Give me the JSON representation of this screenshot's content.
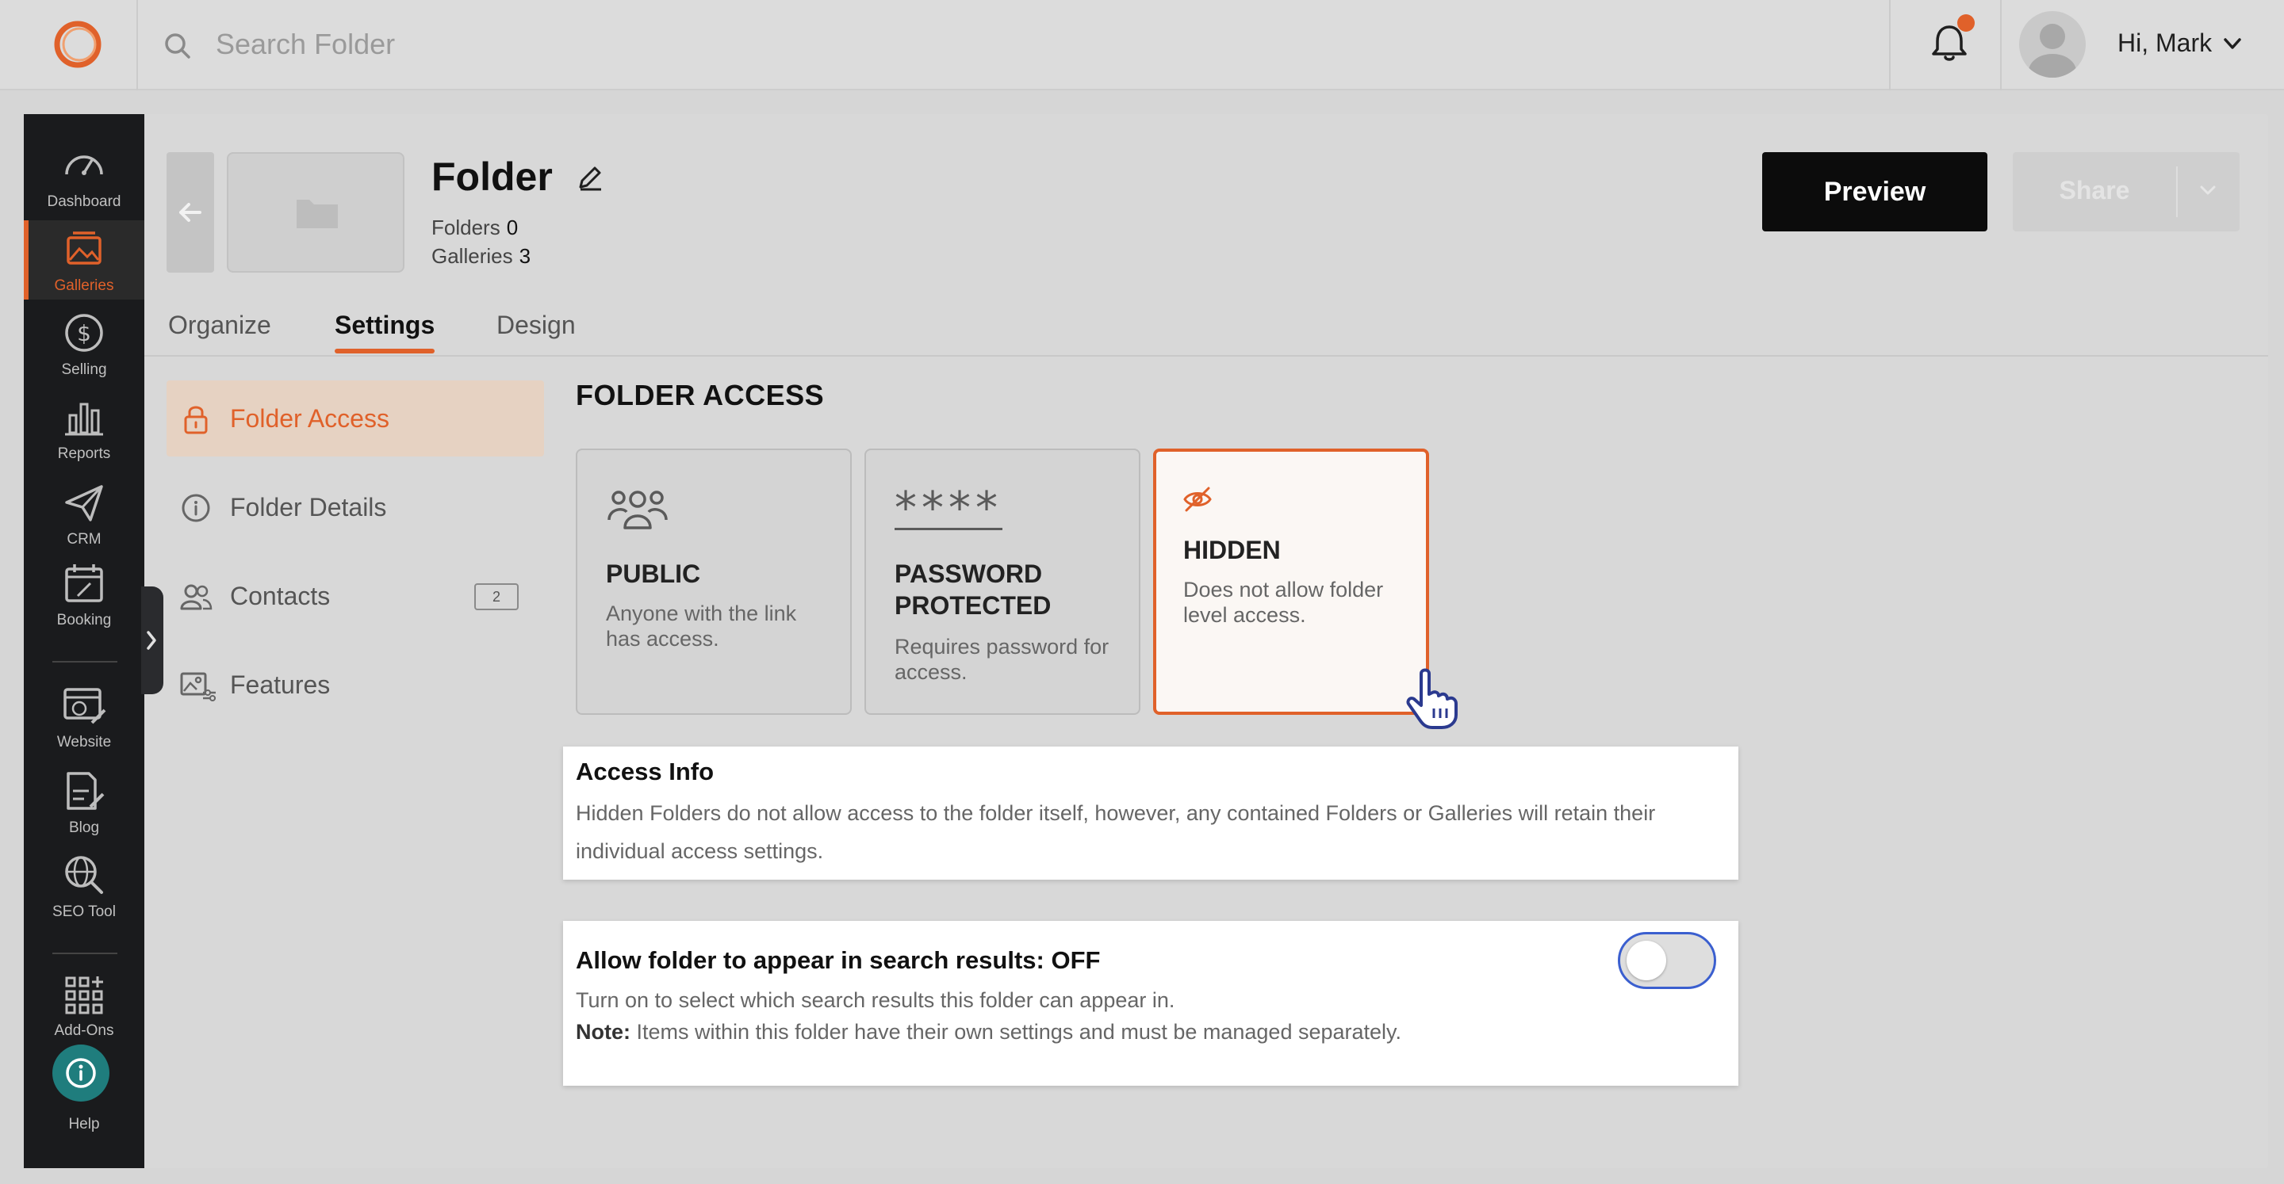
{
  "topbar": {
    "search_placeholder": "Search Folder",
    "greeting": "Hi, Mark"
  },
  "nav": {
    "items": [
      {
        "label": "Dashboard",
        "icon": "dashboard-icon"
      },
      {
        "label": "Galleries",
        "icon": "gallery-icon",
        "active": true
      },
      {
        "label": "Selling",
        "icon": "dollar-icon"
      },
      {
        "label": "Reports",
        "icon": "bar-chart-icon"
      },
      {
        "label": "CRM",
        "icon": "paper-plane-icon"
      },
      {
        "label": "Booking",
        "icon": "calendar-icon"
      },
      {
        "label": "Website",
        "icon": "website-icon"
      },
      {
        "label": "Blog",
        "icon": "blog-icon"
      },
      {
        "label": "SEO Tool",
        "icon": "seo-globe-icon"
      },
      {
        "label": "Add-Ons",
        "icon": "add-ons-grid-icon"
      },
      {
        "label": "Help",
        "icon": "help-icon"
      }
    ]
  },
  "header": {
    "title": "Folder",
    "folders_label": "Folders",
    "folders_count": "0",
    "galleries_label": "Galleries",
    "galleries_count": "3",
    "preview_label": "Preview",
    "share_label": "Share"
  },
  "tabs": [
    {
      "label": "Organize"
    },
    {
      "label": "Settings",
      "active": true
    },
    {
      "label": "Design"
    }
  ],
  "settings_menu": [
    {
      "label": "Folder Access",
      "icon": "lock-icon",
      "active": true
    },
    {
      "label": "Folder Details",
      "icon": "info-icon"
    },
    {
      "label": "Contacts",
      "icon": "contacts-icon",
      "badge": "2"
    },
    {
      "label": "Features",
      "icon": "features-icon"
    }
  ],
  "access": {
    "section_title": "FOLDER ACCESS",
    "options": [
      {
        "title": "PUBLIC",
        "desc": "Anyone with the link has access.",
        "icon": "people-icon"
      },
      {
        "title": "PASSWORD PROTECTED",
        "desc": "Requires password for access.",
        "icon": "password-asterisks-icon",
        "glyph": "****"
      },
      {
        "title": "HIDDEN",
        "desc": "Does not allow folder level access.",
        "icon": "eye-slash-icon",
        "selected": true
      }
    ]
  },
  "access_info": {
    "title": "Access Info",
    "text": "Hidden Folders do not allow access to the folder itself, however, any contained Folders or Galleries will retain their individual access settings."
  },
  "search_results": {
    "title": "Allow folder to appear in search results:",
    "state": "OFF",
    "text": "Turn on to select which search results this folder can appear in.",
    "note_label": "Note:",
    "note_text": "Items within this folder have their own settings and must be managed separately.",
    "toggle_on": false
  },
  "colors": {
    "accent": "#e0612a",
    "nav_bg": "#1a1b1d",
    "help_bg": "#1f7d7d",
    "toggle_border": "#3b5fcf"
  }
}
